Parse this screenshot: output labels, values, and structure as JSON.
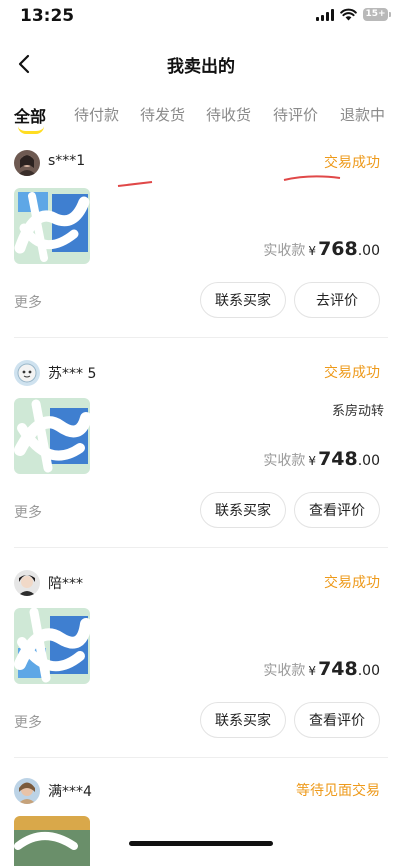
{
  "status_bar": {
    "time": "13:25",
    "battery": "15+"
  },
  "nav": {
    "title": "我卖出的"
  },
  "tabs": [
    {
      "label": "全部",
      "active": true
    },
    {
      "label": "待付款",
      "active": false
    },
    {
      "label": "待发货",
      "active": false
    },
    {
      "label": "待收货",
      "active": false
    },
    {
      "label": "待评价",
      "active": false
    },
    {
      "label": "退款中",
      "active": false
    }
  ],
  "orders": [
    {
      "buyer": "s***1",
      "status": "交易成功",
      "title_fragment": "",
      "price_label": "实收款",
      "currency": "¥",
      "price_int": "768",
      "price_dec": ".00",
      "more": "更多",
      "contact_label": "联系买家",
      "review_label": "去评价"
    },
    {
      "buyer": "苏*** 5",
      "status": "交易成功",
      "title_fragment": "系房动转",
      "price_label": "实收款",
      "currency": "¥",
      "price_int": "748",
      "price_dec": ".00",
      "more": "更多",
      "contact_label": "联系买家",
      "review_label": "查看评价"
    },
    {
      "buyer": "陪*** ",
      "status": "交易成功",
      "title_fragment": "",
      "price_label": "实收款",
      "currency": "¥",
      "price_int": "748",
      "price_dec": ".00",
      "more": "更多",
      "contact_label": "联系买家",
      "review_label": "查看评价"
    },
    {
      "buyer": "满***4",
      "status": "等待见面交易"
    }
  ],
  "colors": {
    "accent_orange": "#ee9a1b",
    "tab_indicator": "#ffdd22"
  }
}
